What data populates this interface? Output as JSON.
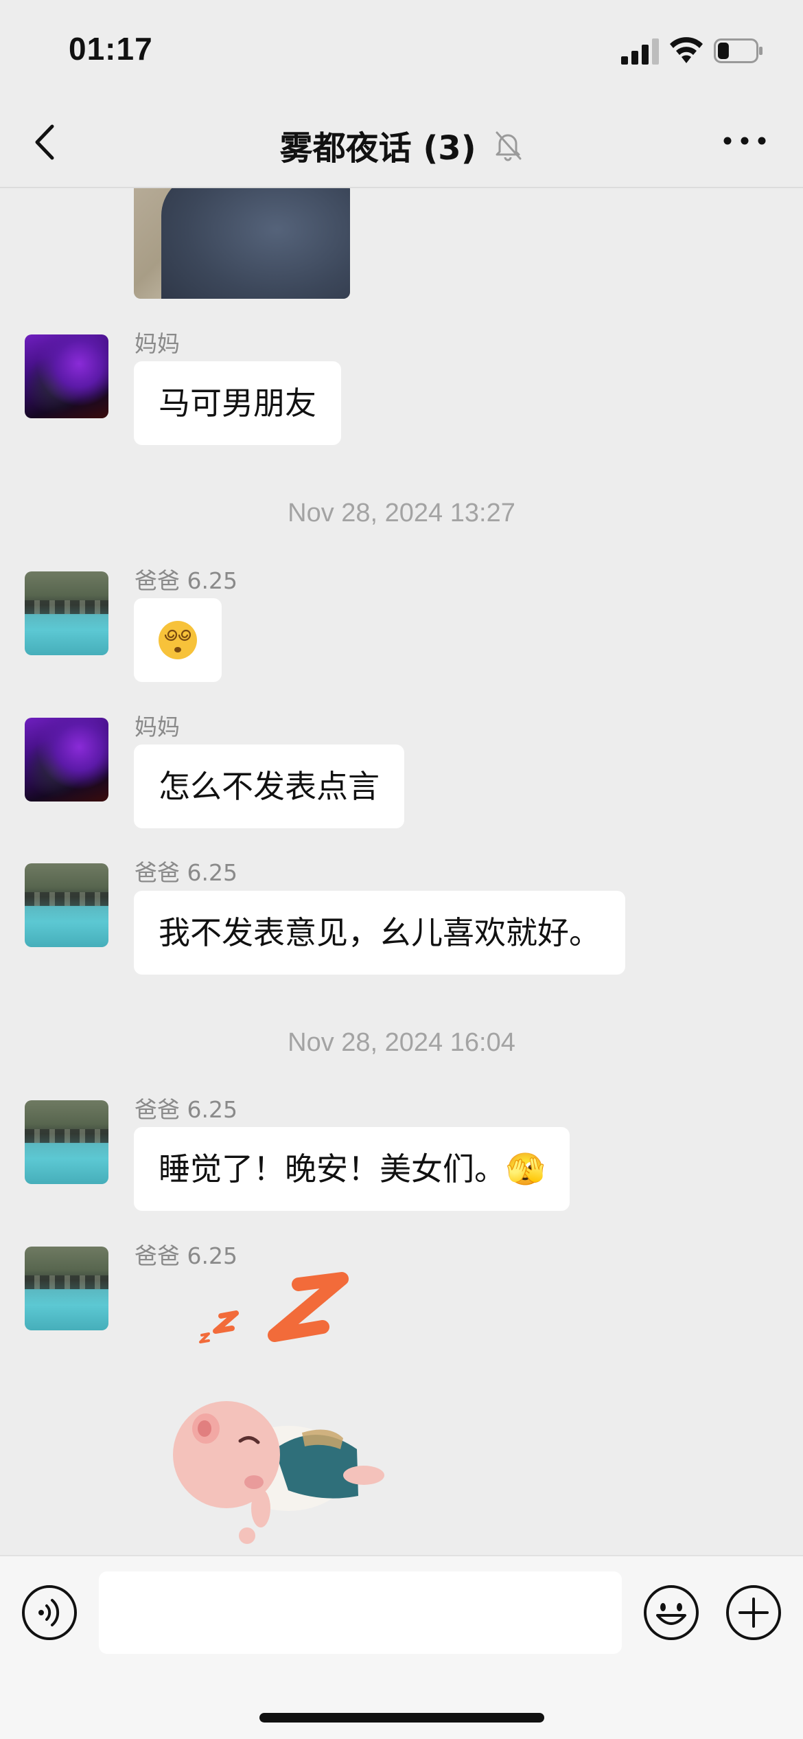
{
  "status_bar": {
    "time": "01:17",
    "battery_level": 0.3
  },
  "header": {
    "title": "雾都夜话 (3)",
    "muted": true
  },
  "messages": [
    {
      "type": "image",
      "sender": "",
      "description_icon": "photo"
    },
    {
      "type": "text",
      "sender": "妈妈",
      "text": "马可男朋友"
    },
    {
      "type": "timestamp",
      "text": "Nov 28, 2024 13:27"
    },
    {
      "type": "text",
      "sender": "爸爸 6.25",
      "text": "😵‍💫"
    },
    {
      "type": "text",
      "sender": "妈妈",
      "text": "怎么不发表点言"
    },
    {
      "type": "text",
      "sender": "爸爸 6.25",
      "text": "我不发表意见，幺儿喜欢就好。"
    },
    {
      "type": "timestamp",
      "text": "Nov 28, 2024 16:04"
    },
    {
      "type": "text",
      "sender": "爸爸 6.25",
      "text": "睡觉了！晚安！美女们。🫣"
    },
    {
      "type": "sticker",
      "sender": "爸爸 6.25",
      "sticker_text": "z z Z"
    }
  ],
  "input": {
    "value": "",
    "placeholder": ""
  },
  "icons": {
    "back": "chevron-left-icon",
    "mute": "bell-slash-icon",
    "more": "ellipsis-icon",
    "voice": "voice-icon",
    "emoji": "smiley-icon",
    "plus": "plus-icon"
  },
  "colors": {
    "background": "#ededed",
    "bubble": "#ffffff",
    "sticker_z": "#f26b3a"
  }
}
